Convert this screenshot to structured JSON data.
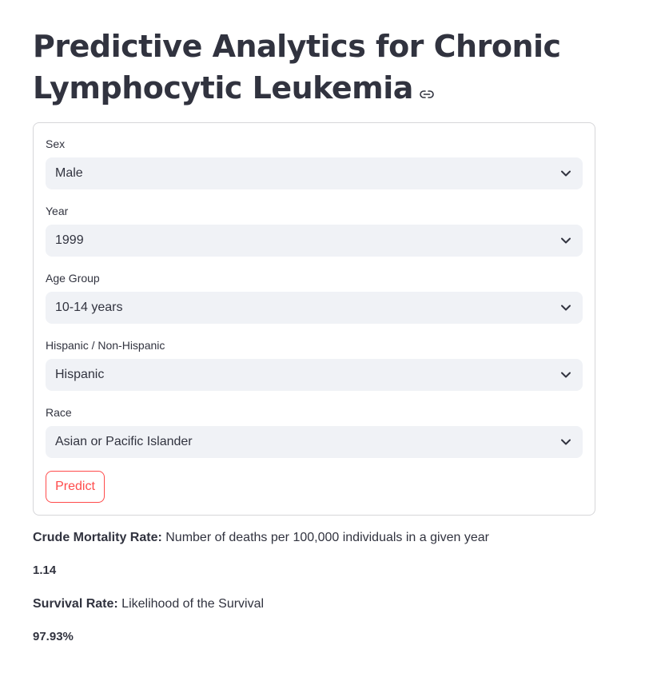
{
  "page": {
    "title": "Predictive Analytics for Chronic Lymphocytic Leukemia",
    "title_icon": "link-icon"
  },
  "form": {
    "fields": [
      {
        "label": "Sex",
        "value": "Male"
      },
      {
        "label": "Year",
        "value": "1999"
      },
      {
        "label": "Age Group",
        "value": "10-14 years"
      },
      {
        "label": "Hispanic / Non-Hispanic",
        "value": "Hispanic"
      },
      {
        "label": "Race",
        "value": "Asian or Pacific Islander"
      }
    ],
    "dropdown_icon": "chevron-down-icon",
    "predict_label": "Predict"
  },
  "results": {
    "mortality_label": "Crude Mortality Rate:",
    "mortality_desc": " Number of deaths per 100,000 individuals in a given year",
    "mortality_value": "1.14",
    "survival_label": "Survival Rate:",
    "survival_desc": " Likelihood of the Survival",
    "survival_value": "97.93%"
  },
  "colors": {
    "accent": "#ff4b4b",
    "select_bg": "#f0f2f6",
    "text": "#31333f",
    "border": "#d6d6d9"
  }
}
